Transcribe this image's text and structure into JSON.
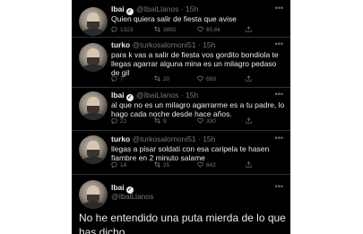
{
  "tweets": [
    {
      "name": "Ibai",
      "handle": "@IbaiLlanos",
      "time": "· 15h",
      "verified": true,
      "text": "Quien quiera salir de fiesta que avise",
      "replies": "1323",
      "retweets": "3892",
      "likes": "60,6k"
    },
    {
      "name": "turko",
      "handle": "@turkosalomoni51",
      "time": "· 15h",
      "verified": false,
      "text": "para k vas a salir de fiesta vos gordito bondiola te llegas agarrar alguna mina es un milagro pedaso de gil",
      "replies": "7",
      "retweets": "20",
      "likes": "689"
    },
    {
      "name": "Ibai",
      "handle": "@IbaiLlanos",
      "time": "· 15h",
      "verified": true,
      "text": "al que no es un milagro agarrarme es a tu padre, lo hago cada noche desde hace años.",
      "replies": "22",
      "retweets": "9",
      "likes": "330"
    },
    {
      "name": "turko",
      "handle": "@turkosalomoni51",
      "time": "· 15h",
      "verified": false,
      "text": "llegas a pisar soldati con esa caripela te hasen fiambre en 2 minuto salame",
      "replies": "14",
      "retweets": "25",
      "likes": "842"
    }
  ],
  "final_tweet": {
    "name": "Ibai",
    "handle": "@IbaiLlanos",
    "verified": true,
    "text": "No he entendido una puta mierda de lo que has dicho"
  },
  "icons": {
    "reply": "reply-icon",
    "retweet": "retweet-icon",
    "like": "heart-icon",
    "share": "share-icon",
    "more": "more-icon",
    "verified": "verified-badge-icon"
  },
  "colors": {
    "background": "#000000",
    "text": "#e7e9ea",
    "muted": "#71767b",
    "divider": "#2f3336"
  }
}
